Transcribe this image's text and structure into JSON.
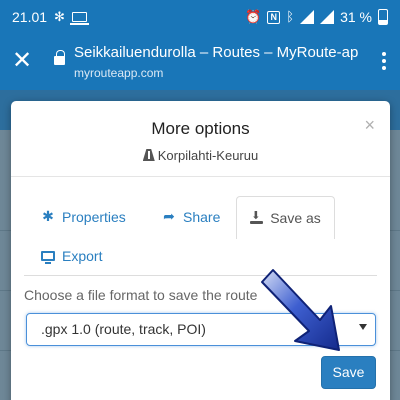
{
  "status_bar": {
    "time": "21.01",
    "battery_percent": "31 %",
    "icons": [
      "fan-icon",
      "laptop-icon",
      "alarm-icon",
      "nfc-icon",
      "bluetooth-icon",
      "wifi-icon",
      "signal-icon",
      "battery-icon"
    ]
  },
  "browser": {
    "page_title": "Seikkailuendurolla – Routes – MyRoute-app",
    "url": "myrouteapp.com",
    "close_icon": "close-icon",
    "menu_icon": "kebab-menu-icon"
  },
  "modal": {
    "title": "More options",
    "subtitle": "Korpilahti-Keuruu",
    "close_symbol": "×",
    "tabs": [
      {
        "label": "Properties",
        "icon": "asterisk-icon",
        "active": false
      },
      {
        "label": "Share",
        "icon": "share-icon",
        "active": false
      },
      {
        "label": "Save as",
        "icon": "download-icon",
        "active": true
      },
      {
        "label": "Export",
        "icon": "monitor-icon",
        "active": false
      }
    ],
    "help_text": "Choose a file format to save the route",
    "select": {
      "selected": ".gpx 1.0 (route, track, POI)"
    },
    "save_label": "Save"
  },
  "colors": {
    "brand_blue": "#1976b8",
    "tab_link": "#2a7fc0",
    "save_button": "#2a7fc0",
    "arrow": "#1f3fae"
  }
}
